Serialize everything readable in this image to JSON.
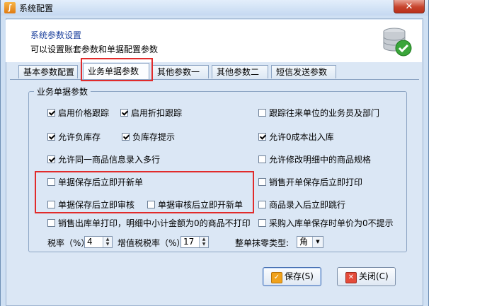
{
  "window": {
    "title": "系统配置",
    "close_label": "✕"
  },
  "header": {
    "title": "系统参数设置",
    "subtitle": "可以设置账套参数和单据配置参数"
  },
  "tabs": [
    {
      "label": "基本参数配置"
    },
    {
      "label": "业务单据参数"
    },
    {
      "label": "其他参数一"
    },
    {
      "label": "其他参数二"
    },
    {
      "label": "短信发送参数"
    }
  ],
  "group": {
    "title": "业务单据参数",
    "options": {
      "price_track": {
        "label": "启用价格跟踪",
        "checked": true
      },
      "discount_track": {
        "label": "启用折扣跟踪",
        "checked": true
      },
      "track_unit_staff": {
        "label": "跟踪往来单位的业务员及部门",
        "checked": false
      },
      "allow_negative_stock": {
        "label": "允许负库存",
        "checked": true
      },
      "negative_stock_hint": {
        "label": "负库存提示",
        "checked": true
      },
      "allow_zero_cost": {
        "label": "允许0成本出入库",
        "checked": true
      },
      "allow_multi_line": {
        "label": "允许同一商品信息录入多行",
        "checked": true
      },
      "allow_modify_spec": {
        "label": "允许修改明细中的商品规格",
        "checked": false
      },
      "save_open_new": {
        "label": "单据保存后立即开新单",
        "checked": false
      },
      "sale_print": {
        "label": "销售开单保存后立即打印",
        "checked": false
      },
      "save_audit": {
        "label": "单据保存后立即审核",
        "checked": false
      },
      "audit_open_new": {
        "label": "单据审核后立即开新单",
        "checked": false
      },
      "item_jump": {
        "label": "商品录入后立即跳行",
        "checked": false
      },
      "no_print_zero": {
        "label": "销售出库单打印，明细中小计金额为0的商品不打印",
        "checked": false
      },
      "no_hint_zero_price": {
        "label": "采购入库单保存时单价为0不提示",
        "checked": false
      }
    },
    "tax_rate_label": "税率（%）:",
    "tax_rate_value": "4",
    "vat_rate_label": "增值税税率（%）:",
    "vat_rate_value": "17",
    "rounding_label": "整单抹零类型:",
    "rounding_value": "角"
  },
  "buttons": {
    "save": "保存(S)",
    "close": "关闭(C)"
  },
  "colors": {
    "highlight": "#e12b2b",
    "header_title": "#1a3f9c"
  }
}
